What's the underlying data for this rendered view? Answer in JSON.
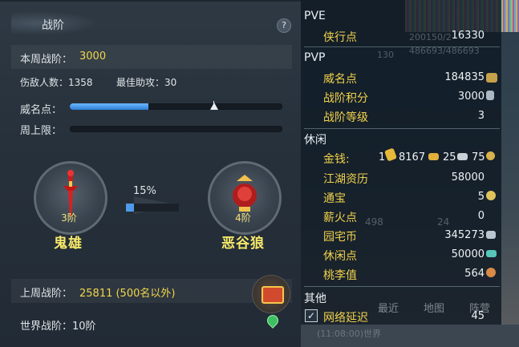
{
  "left_panel": {
    "title": "战阶",
    "help_label": "?",
    "weekly_rank_label": "本周战阶：",
    "weekly_rank_value": "3000",
    "kills_text": "伤敌人数：1358",
    "assists_text": "最佳助攻：30",
    "prestige_label": "威名点：",
    "prestige_progress": 0.37,
    "weekly_cap_label": "周上限：",
    "current_rank": {
      "level": "3阶",
      "name": "鬼雄"
    },
    "progress_percent": "15%",
    "progress_fraction": 0.15,
    "next_rank": {
      "level": "4阶",
      "name": "恶谷狼"
    },
    "last_week_label": "上周战阶：",
    "last_week_value": "25811 (500名以外)",
    "world_rank_text": "世界战阶：10阶"
  },
  "right_panel": {
    "sections": {
      "pve": "PVE",
      "pvp": "PVP",
      "leisure": "休闲",
      "other": "其他"
    },
    "pve_rows": [
      {
        "label": "侠行点",
        "value": "16330"
      }
    ],
    "pvp_rows": [
      {
        "label": "威名点",
        "value": "184835"
      },
      {
        "label": "战阶积分",
        "value": "3000"
      },
      {
        "label": "战阶等级",
        "value": "3"
      }
    ],
    "money": {
      "label": "金钱:",
      "v1": "1",
      "v2": "8167",
      "v3": "25",
      "v4": "75"
    },
    "leisure_rows": [
      {
        "label": "江湖资历",
        "value": "58000"
      },
      {
        "label": "通宝",
        "value": "5"
      },
      {
        "label": "薪火点",
        "value": "0"
      },
      {
        "label": "园宅币",
        "value": "345273"
      },
      {
        "label": "休闲点",
        "value": "50000"
      },
      {
        "label": "桃李值",
        "value": "564"
      }
    ],
    "other_rows": [
      {
        "label": "网络延迟",
        "value": "45",
        "checked": "✓"
      }
    ],
    "background_text": {
      "hp": "200150/2",
      "mp": "486693/486693",
      "lvl": "130",
      "n498": "498",
      "n24": "24",
      "tab_recent": "最近",
      "tab_map": "地图",
      "tab_camp": "阵营",
      "chat": "(11:08:00)世界"
    }
  },
  "colors": {
    "accent_yellow": "#f1d64a",
    "bar_blue": "#3f8de0",
    "panel_bg": "#27313b"
  }
}
